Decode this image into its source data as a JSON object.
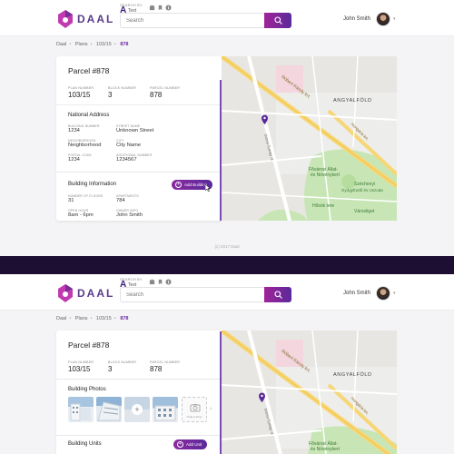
{
  "header": {
    "logo_text": "DAAL",
    "search_by_label": "SEARCH BY",
    "search_mode_letter": "A",
    "search_mode_label": "Text",
    "search_placeholder": "Search",
    "user_name": "John Smith",
    "icons": [
      "logo-pin-icon",
      "building-icon",
      "bookmark-icon",
      "info-icon",
      "search-icon",
      "chevron-down-icon"
    ]
  },
  "breadcrumb": [
    "Daal",
    "Plans",
    "103/15",
    "878"
  ],
  "screen1": {
    "parcel_title": "Parcel #878",
    "stats": [
      {
        "label": "PLAN NUMBER",
        "value": "103/15"
      },
      {
        "label": "BLOCK NUMBER",
        "value": "3"
      },
      {
        "label": "PARCEL NUMBER",
        "value": "878"
      }
    ],
    "address_section": "National Address",
    "address_fields": [
      {
        "label": "BUILDING NUMBER",
        "value": "1234"
      },
      {
        "label": "STREET NAME",
        "value": "Unknown Street"
      },
      {
        "label": "NEIGHBORHOOD",
        "value": "Neighborhood"
      },
      {
        "label": "CITY",
        "value": "City Name"
      },
      {
        "label": "POSTAL CODE",
        "value": "1234"
      },
      {
        "label": "ADDITIONAL NUMBER",
        "value": "1234567"
      }
    ],
    "building_section": "Building Information",
    "add_building_label": "Add Building",
    "building_fields": [
      {
        "label": "NUMBER OF FLOORS",
        "value": "31"
      },
      {
        "label": "APARTMENTS",
        "value": "784"
      },
      {
        "label": "OPEN HOUR",
        "value": "8am - 6pm"
      },
      {
        "label": "OWNER INFO",
        "value": "John Smith"
      }
    ],
    "footer": "(c) 2017 Daal"
  },
  "screen2": {
    "parcel_title": "Parcel #878",
    "stats": [
      {
        "label": "PLAN NUMBER",
        "value": "103/15"
      },
      {
        "label": "BLOCK NUMBER",
        "value": "3"
      },
      {
        "label": "PARCEL NUMBER",
        "value": "878"
      }
    ],
    "photos_section": "Building Photos",
    "drop_label": "Drag & Drop",
    "units_section": "Building Units",
    "add_unit_label": "Add Unit"
  },
  "map": {
    "street_1": "Róbert Károly krt.",
    "district": "ANGYALFÖLD",
    "street_2": "Hungária krt.",
    "street_3": "Dózsa György út",
    "zoo_1": "Fővárosi Állat-",
    "zoo_2": "és Növénykert",
    "bath_1": "Széchenyi",
    "bath_2": "Gyógyfürdő és Uszoda",
    "square": "Hősök tere",
    "park": "Városliget"
  },
  "colors": {
    "accent": "#6a2aa8",
    "brand_gradient_start": "#a0249a",
    "brand_gradient_end": "#5a2a9a",
    "dark_band": "#1d0f33",
    "map_park": "#c8e6b5",
    "map_road_yellow": "#f7d676"
  }
}
